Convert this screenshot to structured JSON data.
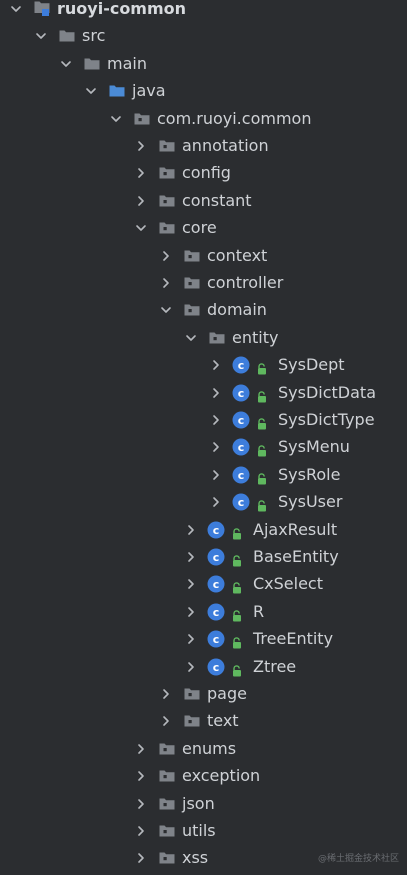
{
  "colors": {
    "background": "#2b2d30",
    "folder": "#7f8389",
    "source_folder": "#4b8bd6",
    "class_circle": "#3d7ddb",
    "lock": "#5fb85f"
  },
  "tree": [
    {
      "label": "ruoyi-common",
      "depth": 0,
      "expanded": true,
      "kind": "module",
      "bold": true
    },
    {
      "label": "src",
      "depth": 1,
      "expanded": true,
      "kind": "folder"
    },
    {
      "label": "main",
      "depth": 2,
      "expanded": true,
      "kind": "folder"
    },
    {
      "label": "java",
      "depth": 3,
      "expanded": true,
      "kind": "source-folder"
    },
    {
      "label": "com.ruoyi.common",
      "depth": 4,
      "expanded": true,
      "kind": "package"
    },
    {
      "label": "annotation",
      "depth": 5,
      "expanded": false,
      "kind": "package"
    },
    {
      "label": "config",
      "depth": 5,
      "expanded": false,
      "kind": "package"
    },
    {
      "label": "constant",
      "depth": 5,
      "expanded": false,
      "kind": "package"
    },
    {
      "label": "core",
      "depth": 5,
      "expanded": true,
      "kind": "package"
    },
    {
      "label": "context",
      "depth": 6,
      "expanded": false,
      "kind": "package"
    },
    {
      "label": "controller",
      "depth": 6,
      "expanded": false,
      "kind": "package"
    },
    {
      "label": "domain",
      "depth": 6,
      "expanded": true,
      "kind": "package"
    },
    {
      "label": "entity",
      "depth": 7,
      "expanded": true,
      "kind": "package"
    },
    {
      "label": "SysDept",
      "depth": 8,
      "expanded": false,
      "kind": "class"
    },
    {
      "label": "SysDictData",
      "depth": 8,
      "expanded": false,
      "kind": "class"
    },
    {
      "label": "SysDictType",
      "depth": 8,
      "expanded": false,
      "kind": "class"
    },
    {
      "label": "SysMenu",
      "depth": 8,
      "expanded": false,
      "kind": "class"
    },
    {
      "label": "SysRole",
      "depth": 8,
      "expanded": false,
      "kind": "class"
    },
    {
      "label": "SysUser",
      "depth": 8,
      "expanded": false,
      "kind": "class"
    },
    {
      "label": "AjaxResult",
      "depth": 7,
      "expanded": false,
      "kind": "class"
    },
    {
      "label": "BaseEntity",
      "depth": 7,
      "expanded": false,
      "kind": "class"
    },
    {
      "label": "CxSelect",
      "depth": 7,
      "expanded": false,
      "kind": "class"
    },
    {
      "label": "R",
      "depth": 7,
      "expanded": false,
      "kind": "class"
    },
    {
      "label": "TreeEntity",
      "depth": 7,
      "expanded": false,
      "kind": "class"
    },
    {
      "label": "Ztree",
      "depth": 7,
      "expanded": false,
      "kind": "class"
    },
    {
      "label": "page",
      "depth": 6,
      "expanded": false,
      "kind": "package"
    },
    {
      "label": "text",
      "depth": 6,
      "expanded": false,
      "kind": "package"
    },
    {
      "label": "enums",
      "depth": 5,
      "expanded": false,
      "kind": "package"
    },
    {
      "label": "exception",
      "depth": 5,
      "expanded": false,
      "kind": "package"
    },
    {
      "label": "json",
      "depth": 5,
      "expanded": false,
      "kind": "package"
    },
    {
      "label": "utils",
      "depth": 5,
      "expanded": false,
      "kind": "package"
    },
    {
      "label": "xss",
      "depth": 5,
      "expanded": false,
      "kind": "package"
    }
  ],
  "watermark": "@稀土掘金技术社区"
}
